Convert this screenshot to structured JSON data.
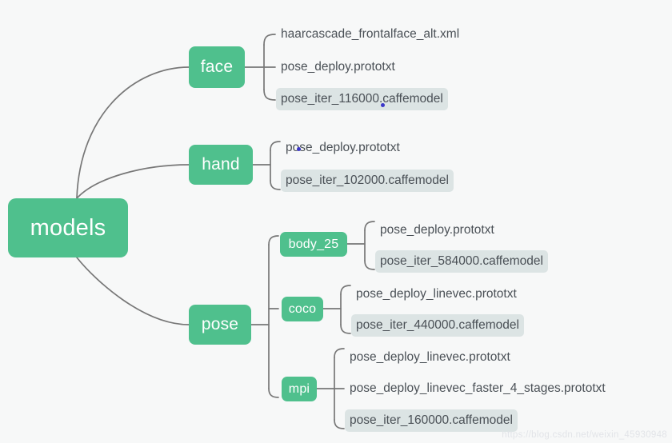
{
  "diagram": {
    "title": "models directory tree mind map",
    "accent_color": "#4FC08D",
    "background_color": "#f7f8f8",
    "connector_color": "#777777",
    "highlight_color": "#dce4e4",
    "text_color": "#4a5056",
    "marker_color": "#3b36c8"
  },
  "root": {
    "label": "models"
  },
  "branches": [
    {
      "label": "face",
      "children": [
        {
          "label": "haarcascade_frontalface_alt.xml",
          "highlighted": false,
          "marker": false
        },
        {
          "label": "pose_deploy.prototxt",
          "highlighted": false,
          "marker": false
        },
        {
          "label": "pose_iter_116000.caffemodel",
          "highlighted": true,
          "marker": true
        }
      ]
    },
    {
      "label": "hand",
      "children": [
        {
          "label": "pose_deploy.prototxt",
          "highlighted": false,
          "marker": true
        },
        {
          "label": "pose_iter_102000.caffemodel",
          "highlighted": true,
          "marker": false
        }
      ]
    },
    {
      "label": "pose",
      "groups": [
        {
          "label": "body_25",
          "children": [
            {
              "label": "pose_deploy.prototxt",
              "highlighted": false,
              "marker": false
            },
            {
              "label": "pose_iter_584000.caffemodel",
              "highlighted": true,
              "marker": false
            }
          ]
        },
        {
          "label": "coco",
          "children": [
            {
              "label": "pose_deploy_linevec.prototxt",
              "highlighted": false,
              "marker": false
            },
            {
              "label": "pose_iter_440000.caffemodel",
              "highlighted": true,
              "marker": false
            }
          ]
        },
        {
          "label": "mpi",
          "children": [
            {
              "label": "pose_deploy_linevec.prototxt",
              "highlighted": false,
              "marker": false
            },
            {
              "label": "pose_deploy_linevec_faster_4_stages.prototxt",
              "highlighted": false,
              "marker": false
            },
            {
              "label": "pose_iter_160000.caffemodel",
              "highlighted": true,
              "marker": false
            }
          ]
        }
      ]
    }
  ],
  "watermark": {
    "text": "https://blog.csdn.net/weixin_45930948"
  }
}
